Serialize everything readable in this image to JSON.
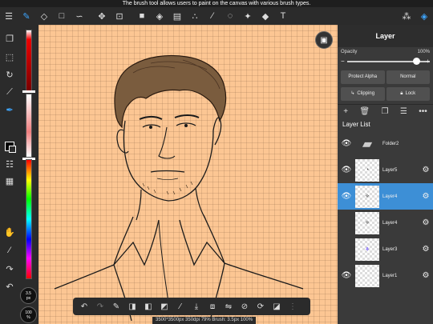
{
  "tooltip": "The brush tool allows users to paint on the canvas with various brush types.",
  "topbar": {
    "icons": [
      "menu-icon",
      "brush-icon",
      "eraser-icon",
      "square-select-icon",
      "smudge-icon",
      "move-icon",
      "transform-icon",
      "fill-color-icon",
      "bucket-icon",
      "gradient-icon",
      "blur-icon",
      "eyedropper-icon",
      "lasso-icon",
      "magic-wand-icon",
      "selection-pen-icon",
      "text-icon",
      "materials-icon",
      "layers-icon"
    ]
  },
  "left": {
    "brush_size": "3.5\npx",
    "opacity": "100\n%"
  },
  "status": "3500*3500px 350dpi 79% Brush: 3.5px 100%",
  "panel": {
    "title": "Layer",
    "opacity_label": "Opacity",
    "opacity_value": "100%",
    "opacity_level": 1.0,
    "protect_alpha": "Protect Alpha",
    "blend_mode": "Normal",
    "clipping": "Clipping",
    "lock": "Lock",
    "layer_list_title": "Layer List",
    "layers": [
      {
        "name": "Folder2",
        "visible": true,
        "type": "folder",
        "selected": false
      },
      {
        "name": "Layer5",
        "visible": true,
        "type": "layer",
        "selected": false
      },
      {
        "name": "Layer4",
        "visible": true,
        "type": "layer",
        "selected": true
      },
      {
        "name": "Layer4",
        "visible": false,
        "type": "layer",
        "selected": false
      },
      {
        "name": "Layer3",
        "visible": false,
        "type": "layer",
        "selected": false
      },
      {
        "name": "Layer1",
        "visible": true,
        "type": "layer",
        "selected": false
      }
    ]
  },
  "colors": {
    "accent": "#3ea6ff",
    "selected_layer": "#3d8fd6",
    "canvas_bg": "#fcc693"
  }
}
